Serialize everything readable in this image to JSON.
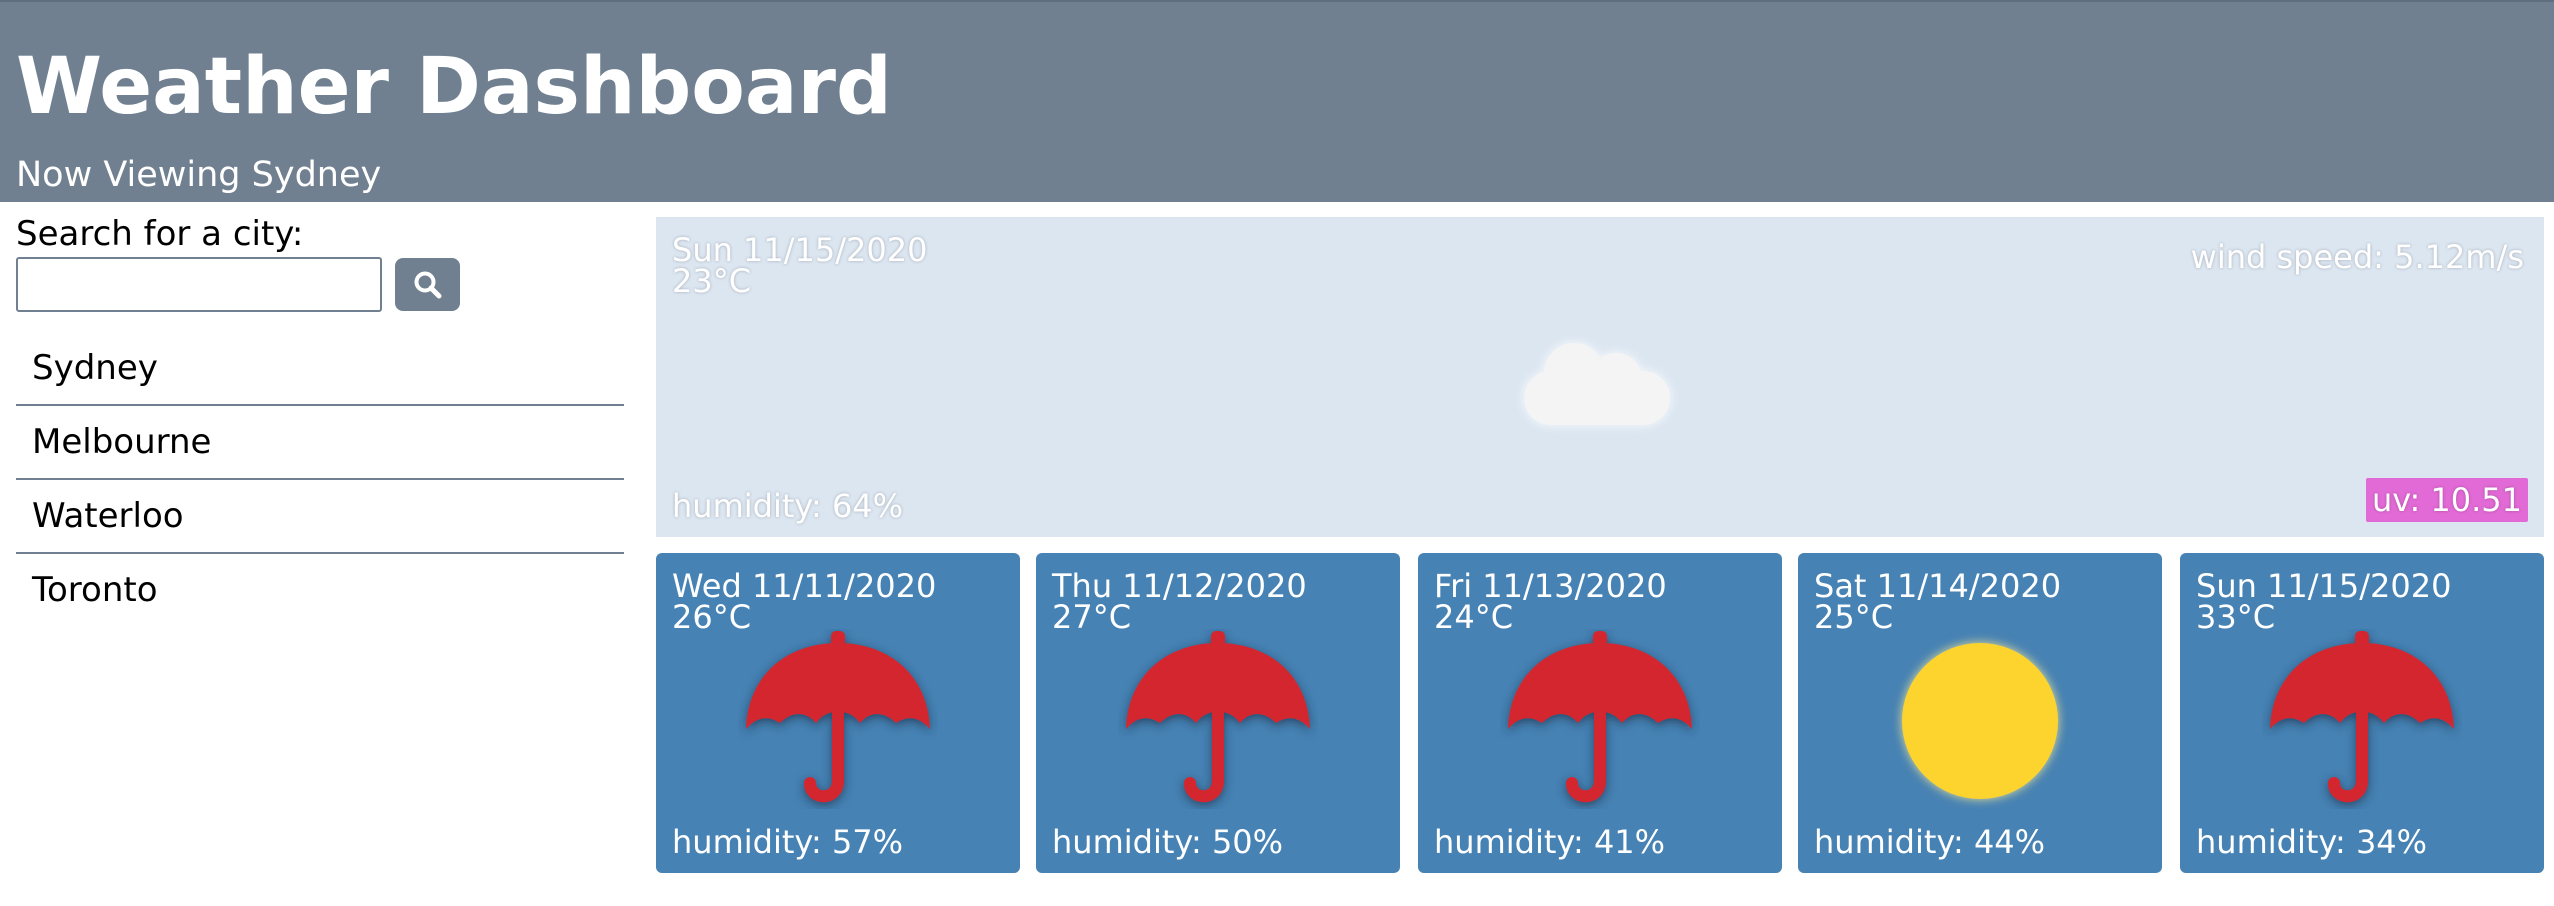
{
  "header": {
    "title": "Weather Dashboard",
    "subtitle": "Now Viewing Sydney"
  },
  "sidebar": {
    "search_label": "Search for a city:",
    "search_value": "",
    "search_placeholder": "",
    "search_icon": "search-icon",
    "cities": [
      "Sydney",
      "Melbourne",
      "Waterloo",
      "Toronto"
    ]
  },
  "current": {
    "date": "Sun 11/15/2020",
    "temp": "23°C",
    "wind": "wind speed: 5.12m/s",
    "humidity": "humidity: 64%",
    "uv": "uv: 10.51",
    "icon": "cloud-icon",
    "uv_color": "#e26ad6"
  },
  "forecast": [
    {
      "date": "Wed 11/11/2020",
      "temp": "26°C",
      "humidity": "humidity: 57%",
      "icon": "umbrella-icon"
    },
    {
      "date": "Thu 11/12/2020",
      "temp": "27°C",
      "humidity": "humidity: 50%",
      "icon": "umbrella-icon"
    },
    {
      "date": "Fri 11/13/2020",
      "temp": "24°C",
      "humidity": "humidity: 41%",
      "icon": "umbrella-icon"
    },
    {
      "date": "Sat 11/14/2020",
      "temp": "25°C",
      "humidity": "humidity: 44%",
      "icon": "sun-icon"
    },
    {
      "date": "Sun 11/15/2020",
      "temp": "33°C",
      "humidity": "humidity: 34%",
      "icon": "umbrella-icon"
    }
  ],
  "colors": {
    "header_bg": "#708090",
    "current_bg": "#dce6f1",
    "forecast_bg": "#4682b4",
    "umbrella": "#d3262f",
    "sun": "#fdd42e"
  }
}
